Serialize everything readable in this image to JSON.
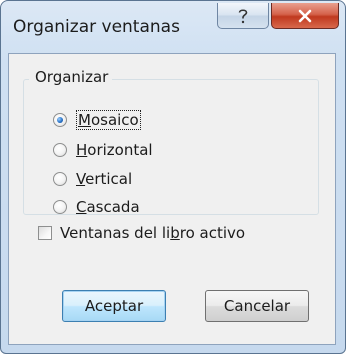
{
  "dialog": {
    "title": "Organizar ventanas",
    "help_glyph": "?",
    "close_glyph": "×",
    "group": {
      "label": "Organizar",
      "options": [
        {
          "key": "M",
          "rest": "osaico",
          "selected": true
        },
        {
          "key": "H",
          "rest": "orizontal",
          "selected": false
        },
        {
          "key": "V",
          "rest": "ertical",
          "selected": false
        },
        {
          "key": "C",
          "rest": "ascada",
          "selected": false
        }
      ]
    },
    "checkbox": {
      "label_before": "Ventanas del li",
      "label_key": "b",
      "label_after": "ro activo",
      "checked": false
    },
    "buttons": {
      "ok": "Aceptar",
      "cancel": "Cancelar"
    }
  },
  "colors": {
    "frame": "#cfe0f2",
    "close": "#c0391f",
    "client": "#f0f0f0",
    "default_button": "#bee6fd"
  }
}
